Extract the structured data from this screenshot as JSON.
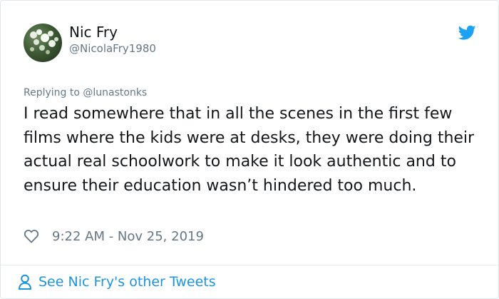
{
  "author": {
    "name": "Nic Fry",
    "handle": "@NicolaFry1980"
  },
  "reply": {
    "text": "Replying to @lunastonks"
  },
  "tweet": {
    "text": "I read somewhere that in all the scenes in the first few films where the kids were at desks, they were doing their actual real schoolwork to make it look authentic and to ensure their education wasn’t hindered too much.",
    "timestamp": "9:22 AM - Nov 25, 2019"
  },
  "footer": {
    "more_label": "See Nic Fry's other Tweets"
  },
  "icons": {
    "brand": "twitter-bird-icon",
    "like": "heart-icon",
    "profile": "person-icon"
  },
  "colors": {
    "brand_blue": "#1da1f2",
    "link_blue": "#1b95e0",
    "muted_gray": "#657786",
    "text_dark": "#14171a"
  }
}
